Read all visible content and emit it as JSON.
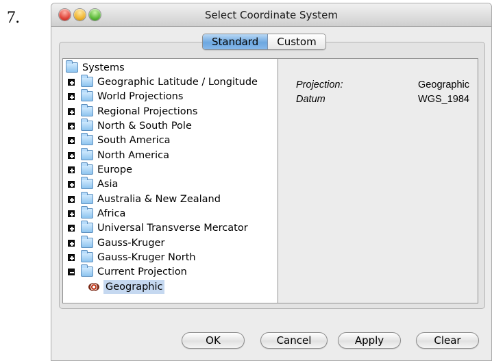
{
  "step_number": "7.",
  "window": {
    "title": "Select Coordinate System"
  },
  "tabs": [
    {
      "label": "Standard",
      "active": true
    },
    {
      "label": "Custom",
      "active": false
    }
  ],
  "tree": {
    "root": "Systems",
    "items": [
      {
        "label": "Geographic Latitude / Longitude",
        "expanded": false
      },
      {
        "label": "World Projections",
        "expanded": false
      },
      {
        "label": "Regional Projections",
        "expanded": false
      },
      {
        "label": "North & South Pole",
        "expanded": false
      },
      {
        "label": "South America",
        "expanded": false
      },
      {
        "label": "North America",
        "expanded": false
      },
      {
        "label": "Europe",
        "expanded": false
      },
      {
        "label": "Asia",
        "expanded": false
      },
      {
        "label": "Australia & New Zealand",
        "expanded": false
      },
      {
        "label": "Africa",
        "expanded": false
      },
      {
        "label": "Universal Transverse Mercator",
        "expanded": false
      },
      {
        "label": "Gauss-Kruger",
        "expanded": false
      },
      {
        "label": "Gauss-Kruger North",
        "expanded": false
      },
      {
        "label": "Current Projection",
        "expanded": true
      }
    ],
    "selected_child": "Geographic"
  },
  "splitter_glyph": "˄",
  "details": {
    "projection_label": "Projection:",
    "projection_value": "Geographic",
    "datum_label": "Datum",
    "datum_value": "WGS_1984"
  },
  "buttons": {
    "ok": "OK",
    "cancel": "Cancel",
    "apply": "Apply",
    "clear": "Clear"
  },
  "colors": {
    "selected_tab": "#6da7e0",
    "selection_highlight": "#c5d8f0"
  }
}
